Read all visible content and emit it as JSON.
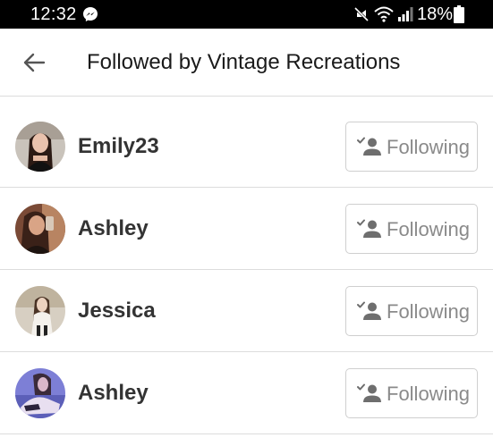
{
  "status_bar": {
    "time": "12:32",
    "battery": "18%",
    "icons": [
      "messenger-icon",
      "mute-icon",
      "wifi-icon",
      "signal-icon",
      "battery-icon"
    ]
  },
  "header": {
    "title": "Followed by Vintage Recreations",
    "back_icon": "arrow-left-icon"
  },
  "list": {
    "items": [
      {
        "name": "Emily23",
        "button_label": "Following",
        "button_icon": "person-check-icon"
      },
      {
        "name": "Ashley",
        "button_label": "Following",
        "button_icon": "person-check-icon"
      },
      {
        "name": "Jessica",
        "button_label": "Following",
        "button_icon": "person-check-icon"
      },
      {
        "name": "Ashley",
        "button_label": "Following",
        "button_icon": "person-check-icon"
      }
    ]
  },
  "colors": {
    "status_bar_bg": "#000000",
    "title_text": "#1a1a1a",
    "username_text": "#333333",
    "button_text": "#8a8a8a",
    "divider": "#dcdcdc"
  }
}
